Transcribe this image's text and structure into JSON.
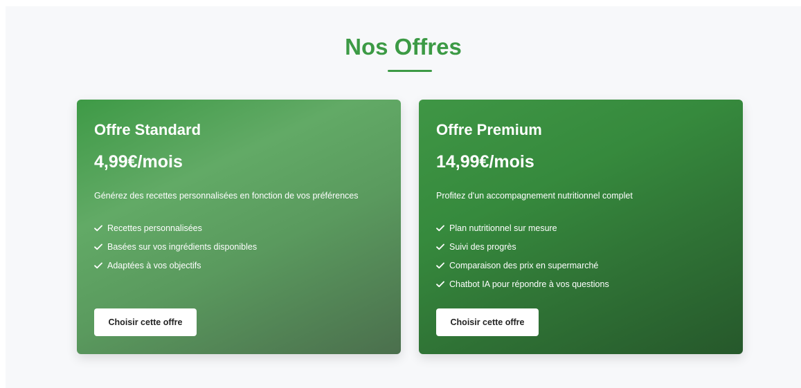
{
  "header": {
    "title": "Nos Offres"
  },
  "colors": {
    "accent": "#3c9a45",
    "standard_card": "#5a9a5e",
    "premium_card": "#2f7235",
    "button_bg": "#ffffff"
  },
  "offers": [
    {
      "name": "Offre Standard",
      "price": "4,99€/mois",
      "description": "Générez des recettes personnalisées en fonction de vos préférences",
      "features": [
        "Recettes personnalisées",
        "Basées sur vos ingrédients disponibles",
        "Adaptées à vos objectifs"
      ],
      "button_label": "Choisir cette offre"
    },
    {
      "name": "Offre Premium",
      "price": "14,99€/mois",
      "description": "Profitez d'un accompagnement nutritionnel complet",
      "features": [
        "Plan nutritionnel sur mesure",
        "Suivi des progrès",
        "Comparaison des prix en supermarché",
        "Chatbot IA pour répondre à vos questions"
      ],
      "button_label": "Choisir cette offre"
    }
  ],
  "icons": {
    "feature_bullet": "check-icon"
  }
}
